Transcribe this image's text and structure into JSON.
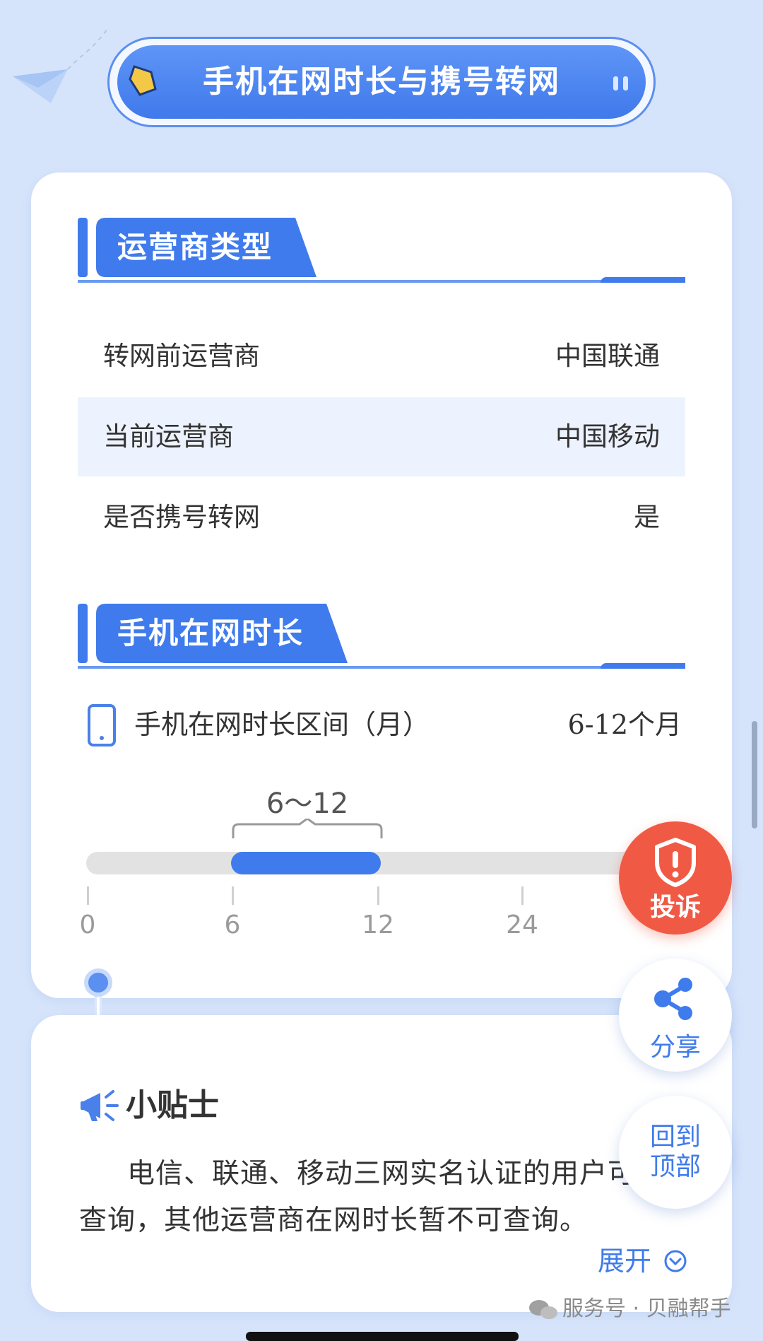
{
  "header": {
    "title": "手机在网时长与携号转网"
  },
  "carrier_section": {
    "heading": "运营商类型",
    "rows": [
      {
        "label": "转网前运营商",
        "value": "中国联通"
      },
      {
        "label": "当前运营商",
        "value": "中国移动"
      },
      {
        "label": "是否携号转网",
        "value": "是"
      }
    ]
  },
  "tenure_section": {
    "heading": "手机在网时长",
    "label": "手机在网时长区间（月）",
    "value": "6-12个月",
    "range_label": "6～12",
    "range_start": 6,
    "range_end": 12,
    "ticks": [
      "0",
      "6",
      "12",
      "24"
    ]
  },
  "tips": {
    "title": "小贴士",
    "text": "电信、联通、移动三网实名认证的用户可以查询，其他运营商在网时长暂不可查询。",
    "expand_label": "展开"
  },
  "floating": {
    "complain_label": "投诉",
    "share_label": "分享",
    "top_label_line1": "回到",
    "top_label_line2": "顶部"
  },
  "watermark": "服务号 · 贝融帮手",
  "colors": {
    "primary": "#3f7bec",
    "background": "#d6e4fb",
    "complain": "#f05a45"
  }
}
